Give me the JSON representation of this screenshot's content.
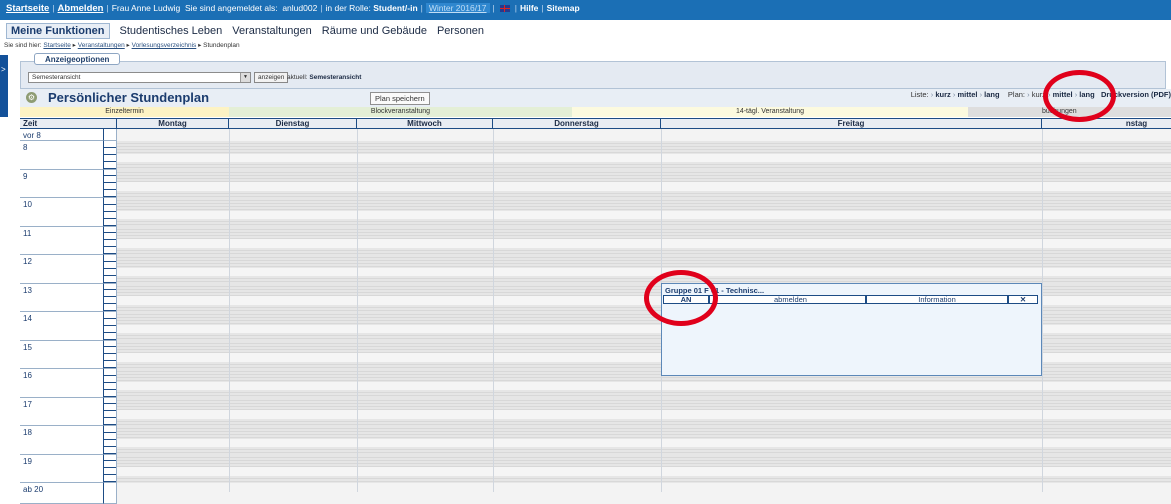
{
  "topbar": {
    "home": "Startseite",
    "logout": "Abmelden",
    "user": "Frau Anne Ludwig",
    "logged_in_as": "Sie sind angemeldet als:",
    "username": "anlud002",
    "role_prefix": "in der Rolle:",
    "role": "Student/-in",
    "semester": "Winter 2016/17",
    "help": "Hilfe",
    "sitemap": "Sitemap"
  },
  "mainnav": {
    "items": [
      "Meine Funktionen",
      "Studentisches Leben",
      "Veranstaltungen",
      "Räume und Gebäude",
      "Personen"
    ]
  },
  "breadcrumb": {
    "prefix": "Sie sind hier:",
    "items": [
      "Startseite",
      "Veranstaltungen",
      "Vorlesungsverzeichnis",
      "Stundenplan"
    ]
  },
  "options": {
    "tab": "Anzeigeoptionen",
    "select_value": "Semesteransicht",
    "show_button": "anzeigen",
    "current_label": "aktuell:",
    "current_value": "Semesteransicht"
  },
  "plan": {
    "title": "Persönlicher Stundenplan",
    "save_button": "Plan speichern",
    "list_label": "Liste:",
    "plan_label": "Plan:",
    "sizes": [
      "kurz",
      "mittel",
      "lang"
    ],
    "print": "Druckversion (PDF)"
  },
  "legend": {
    "single": "Einzeltermin",
    "block": "Blockveranstaltung",
    "biweekly": "14-tägl. Veranstaltung",
    "bookings": "buchungen"
  },
  "timetable": {
    "time_header": "Zeit",
    "days": [
      "Montag",
      "Dienstag",
      "Mittwoch",
      "Donnerstag",
      "Freitag",
      "nstag"
    ],
    "hours": [
      "vor 8",
      "8",
      "9",
      "10",
      "11",
      "12",
      "13",
      "14",
      "15",
      "16",
      "17",
      "18",
      "19",
      "ab 20"
    ]
  },
  "event": {
    "title": "Gruppe 01 F  01 - Technisc...",
    "status": "AN",
    "unsubscribe": "abmelden",
    "info": "Information",
    "close_symbol": "✕"
  },
  "colors": {
    "topbar": "#1b6fb5",
    "highlight_circle": "#e0001b",
    "grid_line": "#1d4c85"
  }
}
